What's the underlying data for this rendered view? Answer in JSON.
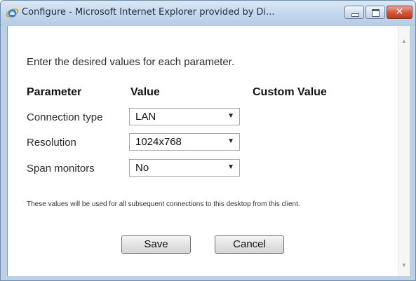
{
  "window": {
    "title": "Configure - Microsoft Internet Explorer provided by Di...",
    "icon": "ie-icon",
    "controls": {
      "minimize": "minimize-icon",
      "maximize": "maximize-icon",
      "close": "close-icon"
    }
  },
  "form": {
    "instructions": "Enter the desired values for each parameter.",
    "headers": {
      "parameter": "Parameter",
      "value": "Value",
      "custom_value": "Custom Value"
    },
    "rows": [
      {
        "label": "Connection type",
        "value": "LAN"
      },
      {
        "label": "Resolution",
        "value": "1024x768"
      },
      {
        "label": "Span monitors",
        "value": "No"
      }
    ],
    "note": "These values will be used for all subsequent connections to this desktop from this client.",
    "save_label": "Save",
    "cancel_label": "Cancel"
  },
  "colors": {
    "titlebar": "#c3d6ec",
    "close_button": "#d4593e",
    "content_bg": "#ffffff"
  }
}
